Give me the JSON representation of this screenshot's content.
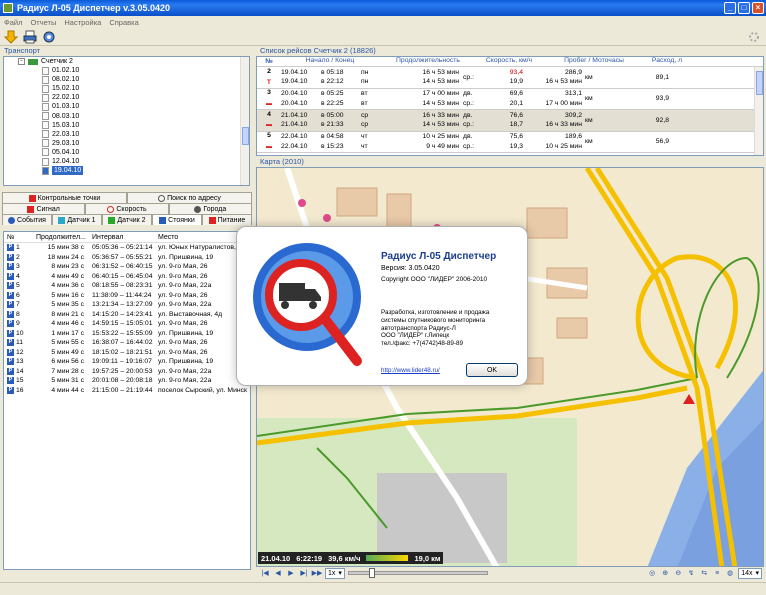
{
  "window": {
    "title": "Радиус Л-05 Диспетчер v.3.05.0420"
  },
  "menu": [
    "Файл",
    "Отчеты",
    "Настройка",
    "Справка"
  ],
  "transport": {
    "title": "Транспорт",
    "root": "Счетчик 2",
    "dates": [
      "01.02.10",
      "08.02.10",
      "15.02.10",
      "22.02.10",
      "01.03.10",
      "08.03.10",
      "15.03.10",
      "22.03.10",
      "29.03.10",
      "05.04.10",
      "12.04.10",
      "19.04.10"
    ],
    "selected": "19.04.10"
  },
  "tabs": {
    "row1": [
      "Контрольные точки",
      "Поиск по адресу"
    ],
    "row2": [
      "Сигнал",
      "Скорость",
      "Города"
    ],
    "row3": [
      "События",
      "Датчик 1",
      "Датчик 2",
      "Стоянки",
      "Питание"
    ]
  },
  "stops": {
    "headers": [
      "№",
      "Продолжител...",
      "Интервал",
      "Место"
    ],
    "rows": [
      [
        "1",
        "15 мин 38 с",
        "05:05:36 – 05:21:14",
        "ул. Юных Натуралистов,"
      ],
      [
        "2",
        "18 мин 24 с",
        "05:36:57 – 05:55:21",
        "ул. Пришвина, 19"
      ],
      [
        "3",
        "8 мин 23 с",
        "06:31:52 – 06:40:15",
        "ул. 9-го Мая, 26"
      ],
      [
        "4",
        "4 мин 49 с",
        "06:40:15 – 06:45:04",
        "ул. 9-го Мая, 26"
      ],
      [
        "5",
        "4 мин 36 с",
        "08:18:55 – 08:23:31",
        "ул. 9-го Мая, 22а"
      ],
      [
        "6",
        "5 мин 16 с",
        "11:38:09 – 11:44:24",
        "ул. 9-го Мая, 26"
      ],
      [
        "7",
        "5 мин 35 с",
        "13:21:34 – 13:27:09",
        "ул. 9-го Мая, 22а"
      ],
      [
        "8",
        "8 мин 21 с",
        "14:15:20 – 14:23:41",
        "ул. Выставочная, 4д"
      ],
      [
        "9",
        "4 мин 46 с",
        "14:59:15 – 15:05:01",
        "ул. 9-го Мая, 26"
      ],
      [
        "10",
        "1 мин 17 с",
        "15:53:22 – 15:55:09",
        "ул. Пришвина, 19"
      ],
      [
        "11",
        "5 мин 55 с",
        "16:38:07 – 16:44:02",
        "ул. 9-го Мая, 26"
      ],
      [
        "12",
        "5 мин 49 с",
        "18:15:02 – 18:21:51",
        "ул. 9-го Мая, 26"
      ],
      [
        "13",
        "6 мин 56 с",
        "19:09:11 – 19:16:07",
        "ул. Пришвина, 19"
      ],
      [
        "14",
        "7 мин 28 с",
        "19:57:25 – 20:00:53",
        "ул. 9-го Мая, 22а"
      ],
      [
        "15",
        "5 мин 31 с",
        "20:01:08 – 20:08:18",
        "ул. 9-го Мая, 22а"
      ],
      [
        "16",
        "4 мин 44 с",
        "21:15:00 – 21:19:44",
        "поселок Сырский, ул. Минск"
      ]
    ]
  },
  "trips": {
    "title": "Список рейсов Счетчик 2  (18826)",
    "headers": [
      "№",
      "Начало / Конец",
      "Продолжительность",
      "Скорость, км/ч",
      "Пробег / Моточасы",
      "Расход, л"
    ],
    "rows": [
      {
        "num": "2",
        "d1": "19.04.10",
        "t1": "в 05:18",
        "w1": "пн",
        "d2": "19.04.10",
        "t2": "в 22:12",
        "w2": "пн",
        "dur1": "16 ч 53 мин",
        "dur2": "14 ч 53 мин",
        "s1l": "",
        "s1": "93,4",
        "s2l": "ср.:",
        "s2": "19,9",
        "m1": "286,9",
        "m1u": "км",
        "m2": "16 ч 53 мин",
        "fuel": "89,1",
        "marker": "T"
      },
      {
        "num": "3",
        "d1": "20.04.10",
        "t1": "в 05:25",
        "w1": "вт",
        "d2": "20.04.10",
        "t2": "в 22:25",
        "w2": "вт",
        "dur1": "17 ч 00 мин",
        "dur2": "14 ч 53 мин",
        "s1l": "дв.",
        "s1": "69,6",
        "s2l": "ср.:",
        "s2": "20,1",
        "m1": "313,1",
        "m1u": "км",
        "m2": "17 ч 00 мин",
        "fuel": "93,9",
        "marker": ""
      },
      {
        "num": "4",
        "d1": "21.04.10",
        "t1": "в 05:00",
        "w1": "ср",
        "d2": "21.04.10",
        "t2": "в 21:33",
        "w2": "ср",
        "dur1": "16 ч 33 мин",
        "dur2": "14 ч 53 мин",
        "s1l": "дв.",
        "s1": "76,6",
        "s2l": "ср.:",
        "s2": "18,7",
        "m1": "309,2",
        "m1u": "км",
        "m2": "16 ч 33 мин",
        "fuel": "92,8",
        "marker": ""
      },
      {
        "num": "5",
        "d1": "22.04.10",
        "t1": "в 04:58",
        "w1": "чт",
        "d2": "22.04.10",
        "t2": "в 15:23",
        "w2": "чт",
        "dur1": "10 ч 25 мин",
        "dur2": "9 ч 49 мин",
        "s1l": "дв.",
        "s1": "75,6",
        "s2l": "ср.:",
        "s2": "19,3",
        "m1": "189,6",
        "m1u": "км",
        "m2": "10 ч 25 мин",
        "fuel": "56,9",
        "marker": ""
      }
    ]
  },
  "map": {
    "title": "Карта  (2010)",
    "status_date": "21.04.10",
    "status_time": "6:22:19",
    "status_speed": "39,6 км/ч",
    "status_dist": "19,0 км",
    "playback_speed": "1x",
    "zoom": "14x"
  },
  "about": {
    "title": "Радиус Л-05 Диспетчер",
    "version_label": "Версия: 3.05.0420",
    "copyright": "Copyright  ООО \"ЛИДЕР\" 2006-2010",
    "desc1": "Разработка, изготовление и продажа",
    "desc2": "системы спутникового мониторинга",
    "desc3": "автотранспорта Радиус-Л",
    "desc4": "ООО \"ЛИДЕР\" г.Липецк",
    "desc5": "тел./факс: +7(4742)48-89-89",
    "link": "http://www.lider48.ru/",
    "ok": "OK"
  },
  "colors": {
    "title_bar": "#0a5ad9",
    "accent": "#2a56a8",
    "speed_red": "#cc0000",
    "map_bg": "#f3e9cf",
    "water": "#8bb0e8"
  }
}
